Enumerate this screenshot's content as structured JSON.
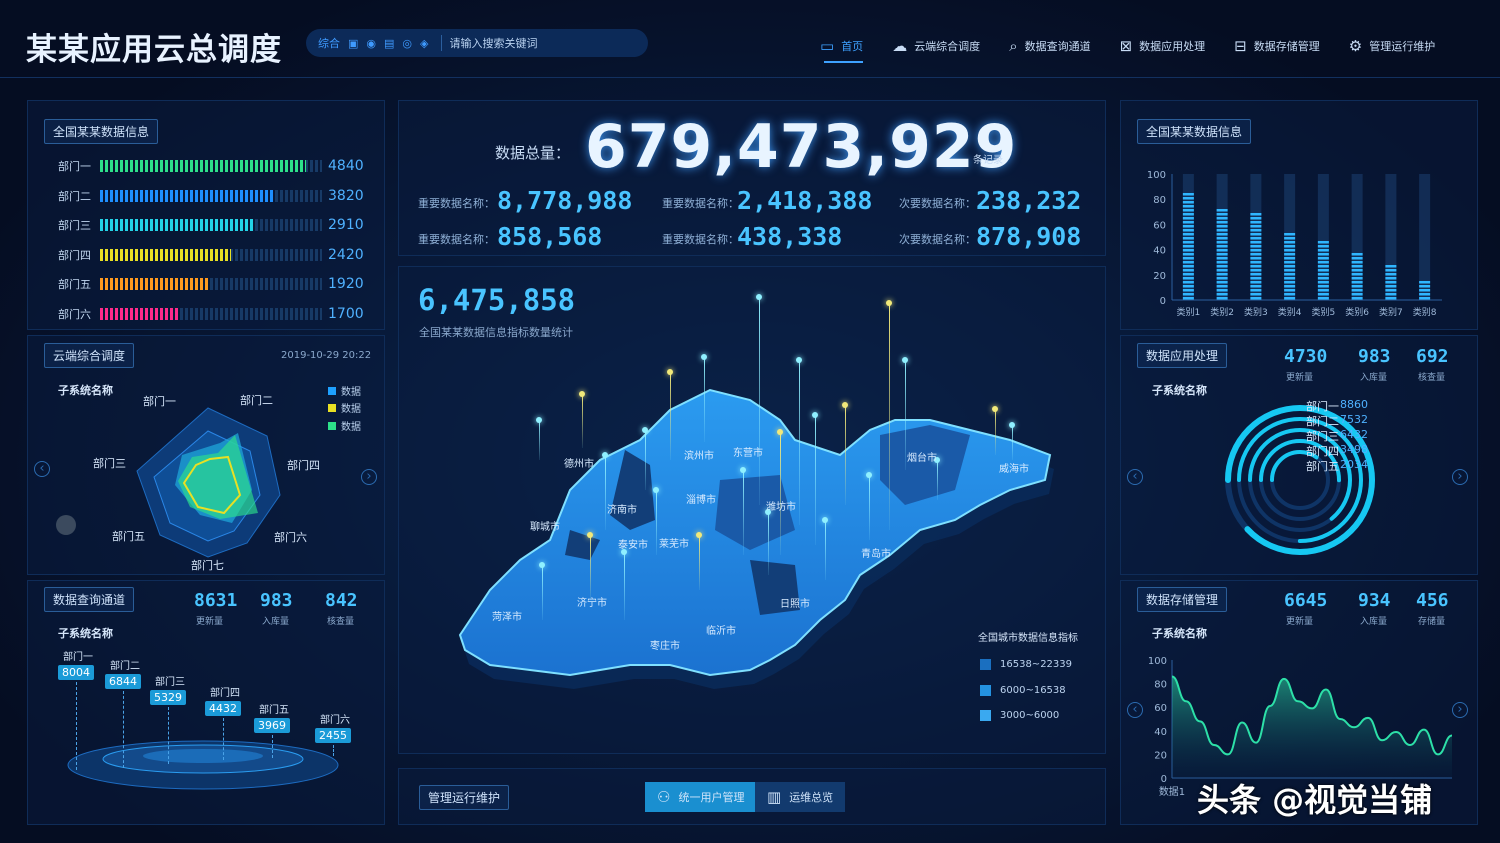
{
  "app": {
    "title": "某某应用云总调度"
  },
  "search": {
    "tools": [
      "综合",
      "▣",
      "◉",
      "▤",
      "◎",
      "◈"
    ],
    "placeholder": "请输入搜索关键词"
  },
  "nav": [
    {
      "label": "首页",
      "icon": "monitor-icon",
      "glyph": "▭",
      "active": true
    },
    {
      "label": "云端综合调度",
      "icon": "cloud-icon",
      "glyph": "☁",
      "active": false
    },
    {
      "label": "数据查询通道",
      "icon": "search-icon",
      "glyph": "⌕",
      "active": false
    },
    {
      "label": "数据应用处理",
      "icon": "grid-icon",
      "glyph": "⊠",
      "active": false
    },
    {
      "label": "数据存储管理",
      "icon": "storage-icon",
      "glyph": "⊟",
      "active": false
    },
    {
      "label": "管理运行维护",
      "icon": "gear-icon",
      "glyph": "⚙",
      "active": false
    }
  ],
  "left_top": {
    "title": "全国某某数据信息",
    "bars": [
      {
        "label": "部门一",
        "value": "4840",
        "fraction": 0.93,
        "color": "#2de08a"
      },
      {
        "label": "部门二",
        "value": "3820",
        "fraction": 0.79,
        "color": "#1e8fff"
      },
      {
        "label": "部门三",
        "value": "2910",
        "fraction": 0.69,
        "color": "#23d3e8"
      },
      {
        "label": "部门四",
        "value": "2420",
        "fraction": 0.59,
        "color": "#e8e024"
      },
      {
        "label": "部门五",
        "value": "1920",
        "fraction": 0.49,
        "color": "#ff9a1f"
      },
      {
        "label": "部门六",
        "value": "1700",
        "fraction": 0.36,
        "color": "#ff2a8a"
      }
    ]
  },
  "radar": {
    "title": "云端综合调度",
    "timestamp": "2019-10-29 20:22",
    "subtitle": "子系统名称",
    "axes": [
      "部门一",
      "部门二",
      "部门四",
      "部门六",
      "部门七",
      "部门五",
      "部门三"
    ],
    "legend": [
      {
        "label": "数据",
        "color": "#1ea0ff"
      },
      {
        "label": "数据",
        "color": "#e8e024"
      },
      {
        "label": "数据",
        "color": "#2de08a"
      }
    ]
  },
  "query": {
    "title": "数据查询通道",
    "subtitle": "子系统名称",
    "stats": [
      {
        "value": "8631",
        "label": "更新量"
      },
      {
        "value": "983",
        "label": "入库量"
      },
      {
        "value": "842",
        "label": "核查量"
      }
    ],
    "steps": [
      {
        "label": "部门一",
        "value": "8004"
      },
      {
        "label": "部门二",
        "value": "6844"
      },
      {
        "label": "部门三",
        "value": "5329"
      },
      {
        "label": "部门四",
        "value": "4432"
      },
      {
        "label": "部门五",
        "value": "3969"
      },
      {
        "label": "部门六",
        "value": "2455"
      }
    ]
  },
  "center": {
    "total_label": "数据总量：",
    "total_value": "679,473,929",
    "total_unit": "条记录",
    "stats": [
      {
        "label": "重要数据名称：",
        "value": "8,778,988"
      },
      {
        "label": "重要数据名称：",
        "value": "2,418,388"
      },
      {
        "label": "次要数据名称：",
        "value": "238,232"
      },
      {
        "label": "重要数据名称：",
        "value": "858,568"
      },
      {
        "label": "重要数据名称：",
        "value": "438,338"
      },
      {
        "label": "次要数据名称：",
        "value": "878,908"
      }
    ],
    "map_value": "6,475,858",
    "map_caption": "全国某某数据信息指标数量统计",
    "cities": [
      "德州市",
      "滨州市",
      "东营市",
      "聊城市",
      "济南市",
      "淄博市",
      "潍坊市",
      "烟台市",
      "威海市",
      "泰安市",
      "莱芜市",
      "青岛市",
      "日照市",
      "济宁市",
      "菏泽市",
      "临沂市",
      "枣庄市"
    ],
    "legend_title": "全国城市数据信息指标",
    "legend": [
      {
        "label": "16538~22339",
        "color": "#1a6fc0"
      },
      {
        "label": "6000~16538",
        "color": "#2492e0"
      },
      {
        "label": "3000~6000",
        "color": "#3aa9f0"
      }
    ]
  },
  "bottom": {
    "title": "管理运行维护",
    "buttons": [
      {
        "label": "统一用户管理",
        "icon": "user-manage-icon",
        "glyph": "⚇",
        "active": true
      },
      {
        "label": "运维总览",
        "icon": "chart-monitor-icon",
        "glyph": "▥",
        "active": false
      }
    ]
  },
  "right_top": {
    "title": "全国某某数据信息",
    "chart_data": {
      "type": "bar",
      "categories": [
        "类别1",
        "类别2",
        "类别3",
        "类别4",
        "类别5",
        "类别6",
        "类别7",
        "类别8"
      ],
      "values": [
        87,
        76,
        71,
        54,
        50,
        40,
        29,
        19
      ],
      "ylim": [
        0,
        100
      ],
      "yticks": [
        0,
        20,
        40,
        60,
        80,
        100
      ]
    }
  },
  "app_proc": {
    "title": "数据应用处理",
    "subtitle": "子系统名称",
    "stats": [
      {
        "value": "4730",
        "label": "更新量"
      },
      {
        "value": "983",
        "label": "入库量"
      },
      {
        "value": "692",
        "label": "核查量"
      }
    ],
    "rings": [
      {
        "label": "部门一",
        "value": "8860",
        "fraction": 0.88
      },
      {
        "label": "部门二",
        "value": "7532",
        "fraction": 0.75
      },
      {
        "label": "部门三",
        "value": "6432",
        "fraction": 0.64
      },
      {
        "label": "部门四",
        "value": "3498",
        "fraction": 0.5
      },
      {
        "label": "部门五",
        "value": "2034",
        "fraction": 0.35
      }
    ]
  },
  "storage": {
    "title": "数据存储管理",
    "subtitle": "子系统名称",
    "stats": [
      {
        "value": "6645",
        "label": "更新量"
      },
      {
        "value": "934",
        "label": "入库量"
      },
      {
        "value": "456",
        "label": "存储量"
      }
    ],
    "chart_data": {
      "type": "area",
      "x": [
        "数据1"
      ],
      "values": [
        86,
        65,
        48,
        28,
        20,
        47,
        30,
        61,
        84,
        65,
        59,
        75,
        50,
        43,
        51,
        32,
        39,
        28,
        41,
        20,
        36
      ],
      "ylim": [
        0,
        100
      ],
      "yticks": [
        0,
        20,
        40,
        60,
        80,
        100
      ]
    }
  },
  "watermark": "头条 @视觉当铺"
}
